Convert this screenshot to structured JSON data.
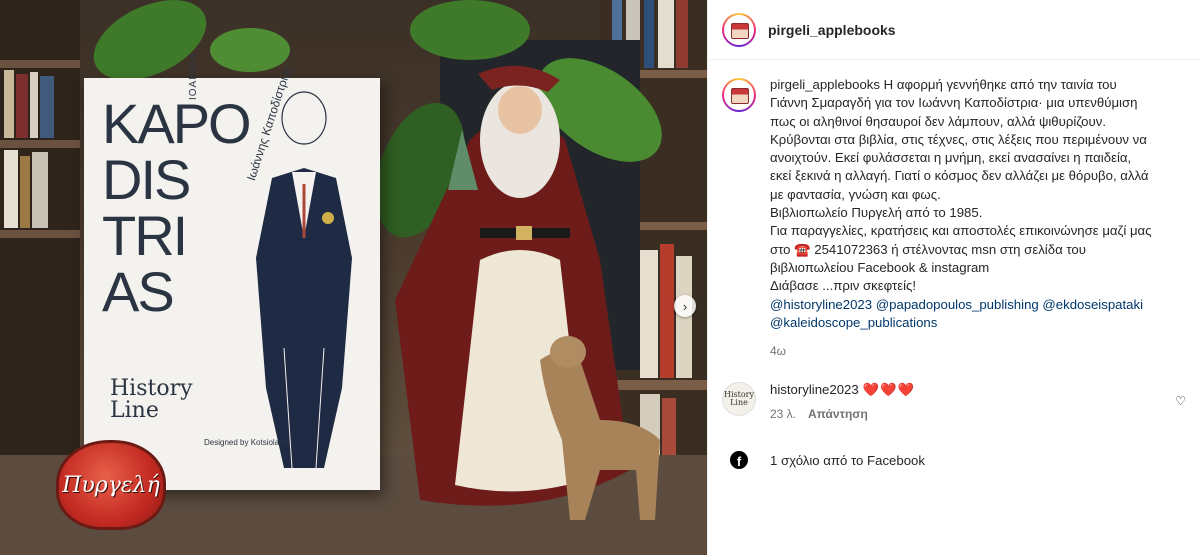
{
  "post": {
    "username": "pirgeli_applebooks",
    "caption_lines": [
      "Η αφορμή γεννήθηκε από την ταινία του",
      "Γιάννη Σμαραγδή για τον Ιωάννη Καποδίστρια· μια υπενθύμιση",
      "πως οι αληθινοί θησαυροί δεν λάμπουν, αλλά ψιθυρίζουν.",
      "Κρύβονται στα βιβλία, στις τέχνες, στις λέξεις που περιμένουν να",
      "ανοιχτούν. Εκεί φυλάσσεται η μνήμη, εκεί ανασαίνει η παιδεία,",
      "εκεί ξεκινά η αλλαγή. Γιατί ο κόσμος δεν αλλάζει με θόρυβο, αλλά",
      "με φαντασία, γνώση και φως.",
      "Βιβλιοπωλείο Πυργελή από το 1985.",
      "Για παραγγελίες, κρατήσεις και αποστολές επικοινώνησε μαζί μας",
      "στο ☎️ 2541072363 ή στέλνοντας msn στη σελίδα του",
      "βιβλιοπωλείου Facebook & instagram",
      "Διάβασε ...πριν σκεφτείς!"
    ],
    "mentions_line1": "@historyline2023 @papadopoulos_publishing @ekdoseispataki",
    "mentions_line2": "@kaleidoscope_publications",
    "time": "4ω"
  },
  "comment": {
    "username": "historyline2023",
    "hearts": "❤️❤️❤️",
    "time": "23 λ.",
    "reply_label": "Απάντηση",
    "avatar_text": "History Line"
  },
  "facebook": {
    "label": "1 σχόλιο από το Facebook"
  },
  "photo": {
    "cover_title": [
      "KAPO",
      "DIS",
      "TRI",
      "AS"
    ],
    "cover_ioannis": "IOANNIS",
    "cover_subtitle": "Ιωάννης Καποδίστριας",
    "cover_logo": [
      "History",
      "Line"
    ],
    "cover_designed": "Designed by Kotsiolanni",
    "apple_tag": "Πυργελή"
  },
  "colors": {
    "mention": "#00376b",
    "heart": "#e0245e",
    "muted": "#737373"
  }
}
